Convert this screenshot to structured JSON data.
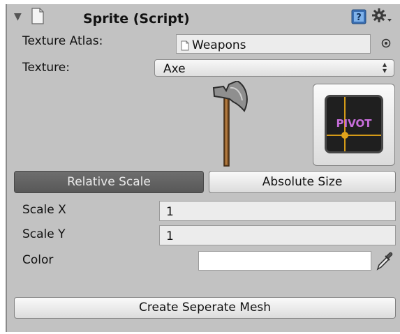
{
  "component": {
    "title": "Sprite (Script)",
    "help_icon": "help-book-icon",
    "settings_icon": "gear-dropdown-icon"
  },
  "fields": {
    "texture_atlas": {
      "label": "Texture Atlas:",
      "value": "Weapons"
    },
    "texture": {
      "label": "Texture:",
      "value": "Axe"
    }
  },
  "preview": {
    "image": "axe-sprite",
    "pivot_label": "PIVOT"
  },
  "scale_mode": {
    "relative_label": "Relative Scale",
    "absolute_label": "Absolute Size",
    "selected": "Relative Scale"
  },
  "scale": {
    "x_label": "Scale X",
    "x_value": "1",
    "y_label": "Scale Y",
    "y_value": "1"
  },
  "color": {
    "label": "Color",
    "value": "#ffffff"
  },
  "actions": {
    "create_mesh_label": "Create Seperate Mesh"
  },
  "colors": {
    "panel_bg": "#c2c2c2",
    "active_button": "#636363",
    "pivot_text": "#c86edc"
  }
}
